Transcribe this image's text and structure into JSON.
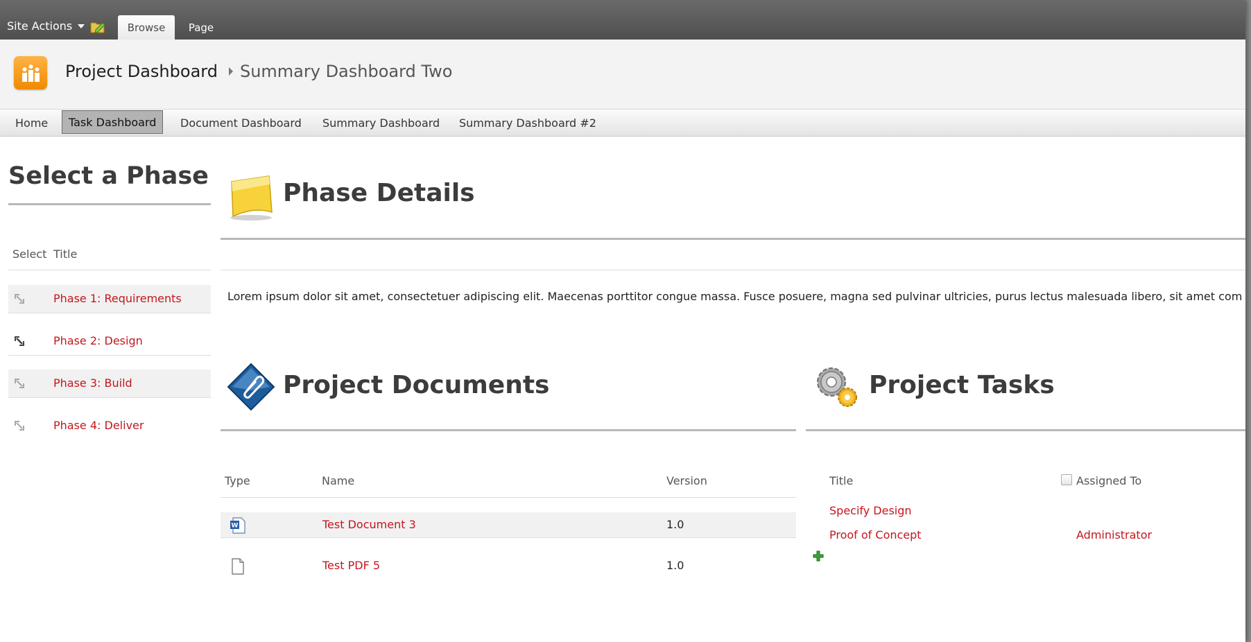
{
  "ribbon": {
    "site_actions": "Site Actions",
    "tabs": [
      "Browse",
      "Page"
    ]
  },
  "title_area": {
    "site_title": "Project Dashboard",
    "page_title": "Summary Dashboard Two"
  },
  "nav": {
    "items": [
      "Home",
      "Task Dashboard",
      "Document Dashboard",
      "Summary Dashboard",
      "Summary Dashboard #2"
    ],
    "active": "Task Dashboard"
  },
  "phases": {
    "heading": "Select a Phase",
    "col_select": "Select",
    "col_title": "Title",
    "items": [
      "Phase 1: Requirements",
      "Phase 2: Design",
      "Phase 3: Build",
      "Phase 4: Deliver"
    ]
  },
  "phase_details": {
    "heading": "Phase Details",
    "body": "Lorem ipsum dolor sit amet, consectetuer adipiscing elit. Maecenas porttitor congue massa. Fusce posuere, magna sed pulvinar ultricies, purus lectus malesuada libero, sit amet com"
  },
  "documents": {
    "heading": "Project Documents",
    "columns": [
      "Type",
      "Name",
      "Version"
    ],
    "rows": [
      {
        "type": "word-doc-icon",
        "name": "Test Document 3",
        "version": "1.0"
      },
      {
        "type": "generic-doc-icon",
        "name": "Test PDF 5",
        "version": "1.0"
      }
    ]
  },
  "tasks": {
    "heading": "Project Tasks",
    "columns": [
      "Title",
      "Assigned To"
    ],
    "rows": [
      {
        "title": "Specify Design",
        "assigned_to": ""
      },
      {
        "title": "Proof of Concept",
        "assigned_to": "Administrator"
      }
    ]
  },
  "colors": {
    "link_red": "#c4161c",
    "ribbon_dark": "#555555",
    "logo_orange": "#f39c12"
  }
}
